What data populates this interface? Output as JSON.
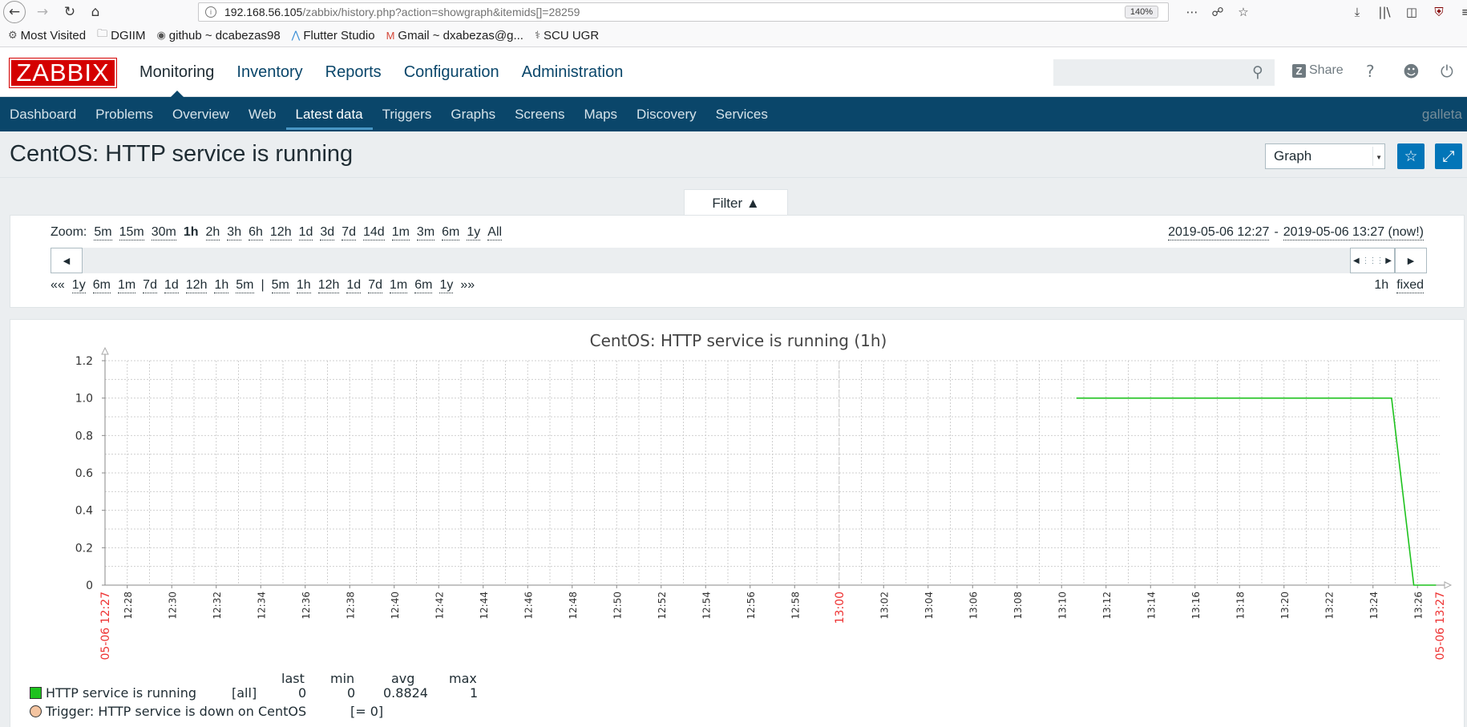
{
  "browser": {
    "url_host": "192.168.56.105",
    "url_path": "/zabbix/history.php?action=showgraph&itemids[]=28259",
    "zoom": "140%",
    "bookmarks": [
      "Most Visited",
      "DGIIM",
      "github ~ dcabezas98",
      "Flutter Studio",
      "Gmail ~ dxabezas@g...",
      "SCU UGR"
    ]
  },
  "header": {
    "logo": "ZABBIX",
    "menu": [
      "Monitoring",
      "Inventory",
      "Reports",
      "Configuration",
      "Administration"
    ],
    "search_placeholder": "",
    "share_label": "Share",
    "help": "?"
  },
  "submenu": {
    "items": [
      "Dashboard",
      "Problems",
      "Overview",
      "Web",
      "Latest data",
      "Triggers",
      "Graphs",
      "Screens",
      "Maps",
      "Discovery",
      "Services"
    ],
    "user": "galleta"
  },
  "page": {
    "title": "CentOS: HTTP service is running",
    "view_select": "Graph"
  },
  "filter": {
    "tab_label": "Filter ▲",
    "zoom_label": "Zoom:",
    "zoom_options": [
      "5m",
      "15m",
      "30m",
      "1h",
      "2h",
      "3h",
      "6h",
      "12h",
      "1d",
      "3d",
      "7d",
      "14d",
      "1m",
      "3m",
      "6m",
      "1y",
      "All"
    ],
    "zoom_selected": "1h",
    "from": "2019-05-06 12:27",
    "range_sep": "-",
    "to": "2019-05-06 13:27 (now!)",
    "back_start": "«« ",
    "back": [
      "1y",
      "6m",
      "1m",
      "7d",
      "1d",
      "12h",
      "1h",
      "5m"
    ],
    "sep": "|",
    "forward": [
      "5m",
      "1h",
      "12h",
      "1d",
      "7d",
      "1m",
      "6m",
      "1y"
    ],
    "forward_end": "»»",
    "period": "1h",
    "mode": "fixed"
  },
  "chart_data": {
    "type": "line",
    "title": "CentOS: HTTP service is running (1h)",
    "x_start_label": "05-06 12:27",
    "x_end_label": "05-06 13:27",
    "x_ticks": [
      "12:28",
      "12:30",
      "12:32",
      "12:34",
      "12:36",
      "12:38",
      "12:40",
      "12:42",
      "12:44",
      "12:46",
      "12:48",
      "12:50",
      "12:52",
      "12:54",
      "12:56",
      "12:58",
      "13:00",
      "13:02",
      "13:04",
      "13:06",
      "13:08",
      "13:10",
      "13:12",
      "13:14",
      "13:16",
      "13:18",
      "13:20",
      "13:22",
      "13:24",
      "13:26"
    ],
    "x_highlight": "13:00",
    "y_ticks": [
      "0",
      "0.2",
      "0.4",
      "0.6",
      "0.8",
      "1.0",
      "1.2"
    ],
    "ylim": [
      0,
      1.2
    ],
    "grid": true,
    "series": [
      {
        "name": "HTTP service is running",
        "color": "#1ec21e",
        "x": [
          "13:10:40",
          "13:24:50",
          "13:25:50",
          "13:26:50"
        ],
        "values": [
          1,
          1,
          0,
          0
        ]
      }
    ],
    "legend": {
      "columns": [
        "last",
        "min",
        "avg",
        "max"
      ],
      "item": {
        "label": "HTTP service is running",
        "func": "[all]",
        "last": "0",
        "min": "0",
        "avg": "0.8824",
        "max": "1"
      },
      "trigger": {
        "label": "Trigger: HTTP service is down on CentOS",
        "value": "[= 0]",
        "color": "#f4c4a0"
      }
    }
  }
}
